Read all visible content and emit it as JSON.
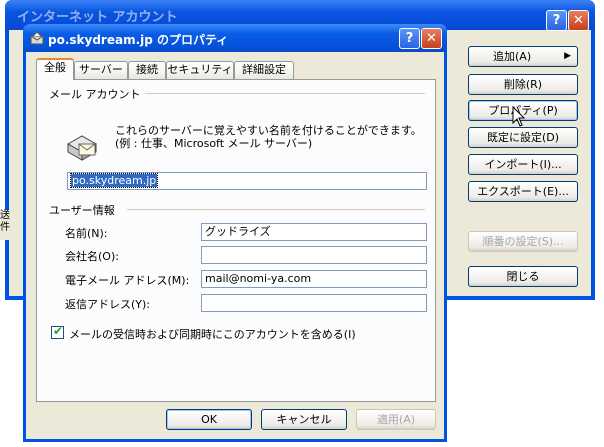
{
  "background_window": {
    "title": "インターネット アカウント",
    "buttons": {
      "add": "追加(A)",
      "add_arrow": "▶",
      "delete": "削除(R)",
      "properties": "プロパティ(P)",
      "set_default": "既定に設定(D)",
      "import": "インポート(I)...",
      "export": "エクスポート(E)...",
      "set_order": "順番の設定(S)...",
      "close": "閉じる"
    },
    "help_glyph": "?",
    "close_glyph": "✕",
    "left_strip_text": "送\n件"
  },
  "dialog": {
    "title": "po.skydream.jp のプロパティ",
    "help_glyph": "?",
    "close_glyph": "✕",
    "tabs": [
      {
        "label": "全般",
        "active": true
      },
      {
        "label": "サーバー",
        "active": false
      },
      {
        "label": "接続",
        "active": false
      },
      {
        "label": "セキュリティ",
        "active": false
      },
      {
        "label": "詳細設定",
        "active": false
      }
    ],
    "mail_account": {
      "group_label": "メール アカウント",
      "description": "これらのサーバーに覚えやすい名前を付けることができます。(例 : 仕事、Microsoft メール サーバー)",
      "account_name": "po.skydream.jp"
    },
    "user_info": {
      "group_label": "ユーザー情報",
      "name_label": "名前(N):",
      "name_value": "グッドライズ",
      "company_label": "会社名(O):",
      "company_value": "",
      "email_label": "電子メール アドレス(M):",
      "email_value": "mail@nomi-ya.com",
      "reply_label": "返信アドレス(Y):",
      "reply_value": ""
    },
    "include_checkbox": {
      "label": "メールの受信時および同期時にこのアカウントを含める(I)",
      "checked": true
    },
    "footer": {
      "ok": "OK",
      "cancel": "キャンセル",
      "apply": "適用(A)"
    }
  },
  "colors": {
    "title_blue": "#0054e3",
    "dialog_face": "#ece9d8",
    "selection": "#316ac5",
    "tab_accent": "#e68b2c"
  }
}
